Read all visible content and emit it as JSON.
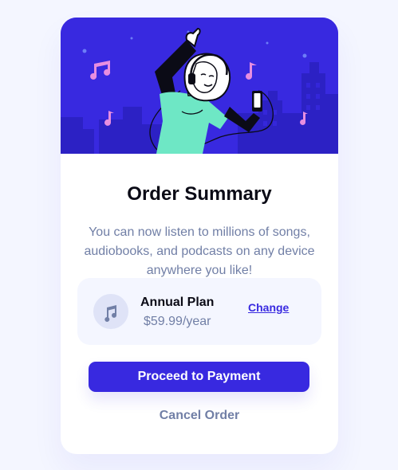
{
  "summary": {
    "title": "Order Summary",
    "description": "You can now listen to millions of songs, audiobooks, and podcasts on any device anywhere you like!"
  },
  "plan": {
    "name": "Annual Plan",
    "price": "$59.99/year",
    "change_label": "Change",
    "icon": "music-note-icon"
  },
  "actions": {
    "proceed_label": "Proceed to Payment",
    "cancel_label": "Cancel Order"
  },
  "colors": {
    "page_background": "#f4f6ff",
    "card_background": "#ffffff",
    "primary": "#3829e0",
    "heading": "#0b0b16",
    "muted_text": "#717fa6",
    "plan_background": "#f4f6ff",
    "hero_shirt": "#6ee7c5",
    "hero_notes": "#e78ee0"
  }
}
